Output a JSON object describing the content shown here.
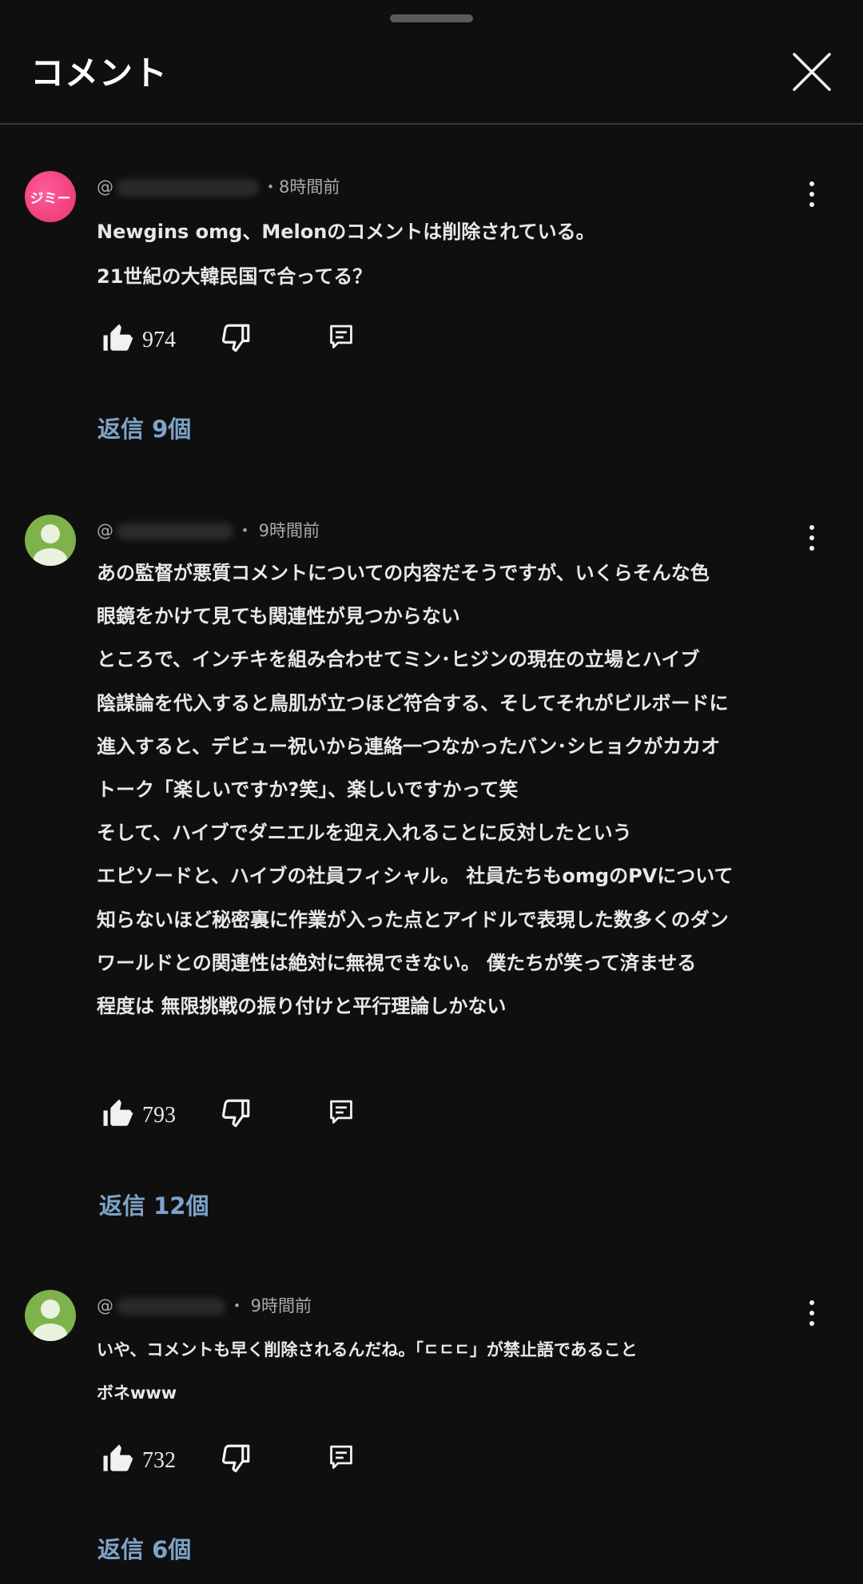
{
  "header": {
    "title": "コメント"
  },
  "comments": [
    {
      "avatar_text": "ジミー",
      "handle_prefix": "@",
      "time": "・8時間前",
      "lines": [
        "Newgins omg、Melonのコメントは削除されている。",
        "21世紀の大韓民国で合ってる？"
      ],
      "likes": "974",
      "replies": "返信 9個"
    },
    {
      "avatar_text": "",
      "handle_prefix": "@",
      "time": "・ 9時間前",
      "lines": [
        "あの監督が悪質コメントについての内容だそうですが、いくらそんな色",
        "眼鏡をかけて見ても関連性が見つからない",
        "ところで、インチキを組み合わせてミン･ヒジンの現在の立場とハイブ",
        "陰謀論を代入すると鳥肌が立つほど符合する、そしてそれがビルボードに",
        "進入すると、デビュー祝いから連絡一つなかったバン･シヒョクがカカオ",
        "トーク「楽しいですか?笑」、楽しいですかって笑",
        "そして、ハイブでダニエルを迎え入れることに反対したという",
        "エピソードと、ハイブの社員フィシャル。 社員たちもomgのPVについて",
        "知らないほど秘密裏に作業が入った点とアイドルで表現した数多くのダン",
        "ワールドとの関連性は絶対に無視できない。 僕たちが笑って済ませる",
        "程度は 無限挑戦の振り付けと平行理論しかない"
      ],
      "likes": "793",
      "replies": "返信 12個"
    },
    {
      "avatar_text": "",
      "handle_prefix": "@",
      "time": "・ 9時間前",
      "lines": [
        "いや、コメントも早く削除されるんだね。「ㄷㄷㄷ」が禁止語であること",
        "ボネwww"
      ],
      "likes": "732",
      "replies": "返信 6個"
    }
  ],
  "colors": {
    "background": "#0f0f0f",
    "link": "#7ea3c9",
    "avatar_pink": "#e8336f",
    "avatar_green": "#7eb24a"
  },
  "icons": {
    "close": "close-icon",
    "more": "more-vertical-icon",
    "like": "thumbs-up-icon",
    "dislike": "thumbs-down-icon",
    "reply": "comment-icon",
    "default_avatar": "person-avatar-icon"
  }
}
